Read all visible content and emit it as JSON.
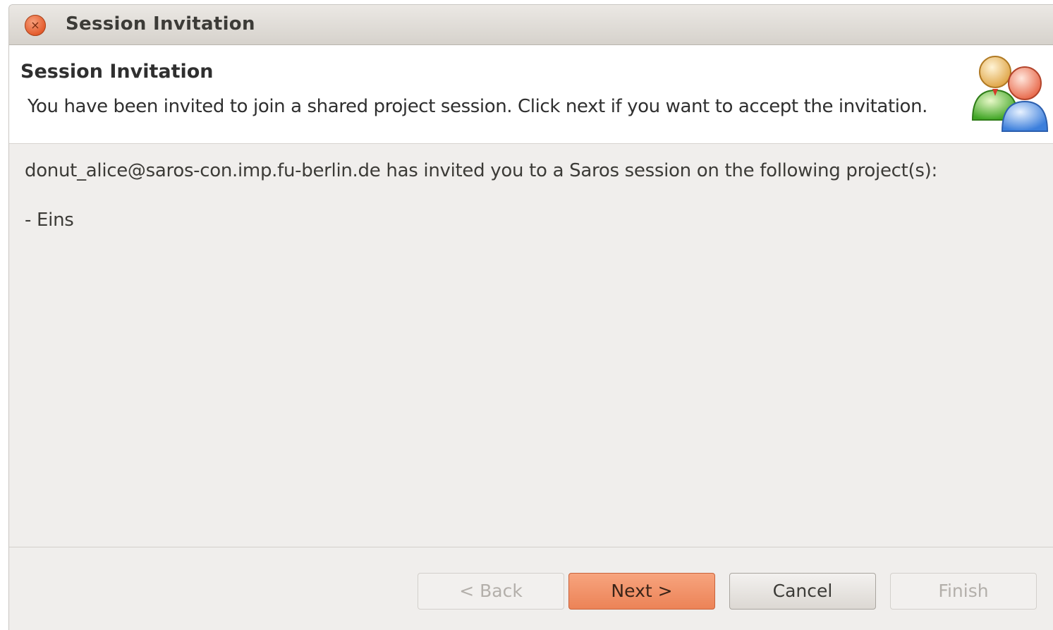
{
  "window": {
    "title": "Session Invitation",
    "close_glyph": "×"
  },
  "header": {
    "title": "Session Invitation",
    "description": "You have been invited to join a shared project session. Click next if you want to accept the invitation.",
    "icon": "users-icon"
  },
  "content": {
    "invitation_text": "donut_alice@saros-con.imp.fu-berlin.de has invited you to a Saros session on the following project(s):",
    "projects": [
      "- Eins"
    ]
  },
  "buttons": {
    "back_label": "< Back",
    "next_label": "Next >",
    "cancel_label": "Cancel",
    "finish_label": "Finish"
  },
  "colors": {
    "accent": "#ec8357",
    "close": "#e3592a",
    "background": "#f0eeec"
  }
}
